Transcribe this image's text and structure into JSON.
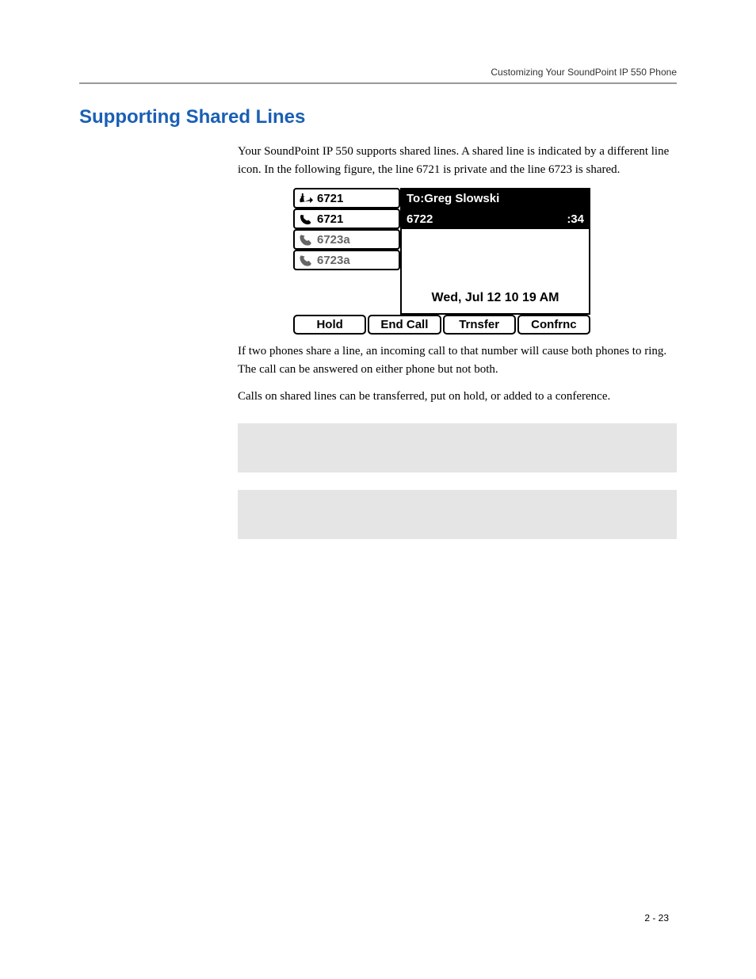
{
  "header": {
    "running_head": "Customizing Your SoundPoint IP 550 Phone"
  },
  "section": {
    "title": "Supporting Shared Lines",
    "para1": "Your SoundPoint IP 550 supports shared lines. A shared line is indicated by a different line icon. In the following figure, the line 6721 is private and the line 6723 is shared.",
    "para2": "If two phones share a line, an incoming call to that number will cause both phones to ring. The call can be answered on either phone but not both.",
    "para3": "Calls on shared lines can be transferred, put on hold, or added to a conference."
  },
  "phone": {
    "lines": [
      {
        "label": "6721",
        "icon": "offhook",
        "style": "black"
      },
      {
        "label": "6721",
        "icon": "phone",
        "style": "black"
      },
      {
        "label": "6723a",
        "icon": "phone",
        "style": "gray"
      },
      {
        "label": "6723a",
        "icon": "phone",
        "style": "gray"
      }
    ],
    "call_to": "To:Greg Slowski",
    "call_num": "6722",
    "call_timer": ":34",
    "datetime": "Wed, Jul 12  10 19 AM",
    "softkeys": [
      "Hold",
      "End Call",
      "Trnsfer",
      "Confrnc"
    ]
  },
  "footer": {
    "page": "2 - 23"
  }
}
